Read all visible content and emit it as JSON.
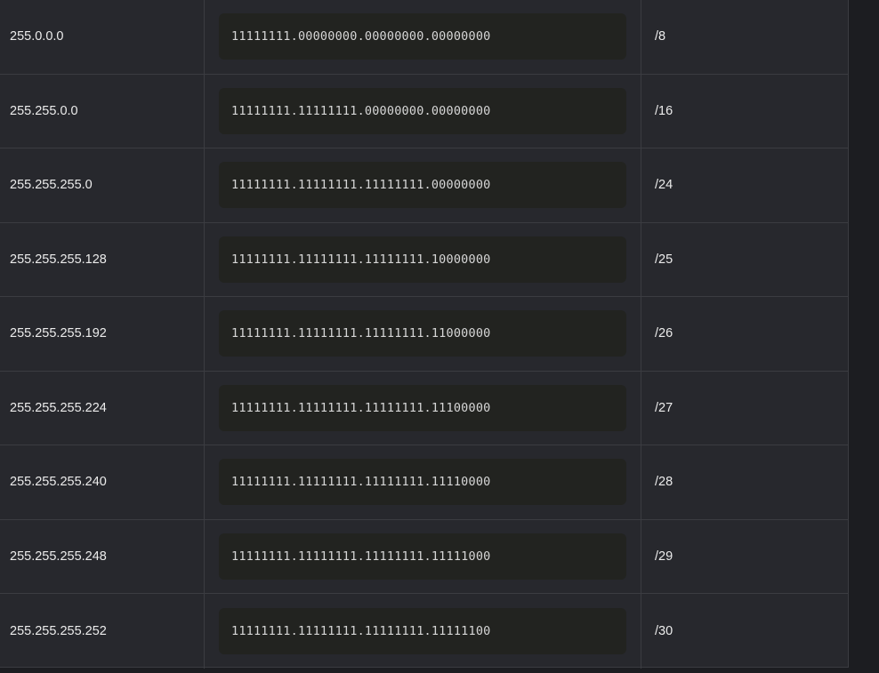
{
  "rows": [
    {
      "mask": "255.0.0.0",
      "binary": "11111111.00000000.00000000.00000000",
      "cidr": "/8"
    },
    {
      "mask": "255.255.0.0",
      "binary": "11111111.11111111.00000000.00000000",
      "cidr": "/16"
    },
    {
      "mask": "255.255.255.0",
      "binary": "11111111.11111111.11111111.00000000",
      "cidr": "/24"
    },
    {
      "mask": "255.255.255.128",
      "binary": "11111111.11111111.11111111.10000000",
      "cidr": "/25"
    },
    {
      "mask": "255.255.255.192",
      "binary": "11111111.11111111.11111111.11000000",
      "cidr": "/26"
    },
    {
      "mask": "255.255.255.224",
      "binary": "11111111.11111111.11111111.11100000",
      "cidr": "/27"
    },
    {
      "mask": "255.255.255.240",
      "binary": "11111111.11111111.11111111.11110000",
      "cidr": "/28"
    },
    {
      "mask": "255.255.255.248",
      "binary": "11111111.11111111.11111111.11111000",
      "cidr": "/29"
    },
    {
      "mask": "255.255.255.252",
      "binary": "11111111.11111111.11111111.11111100",
      "cidr": "/30"
    }
  ]
}
